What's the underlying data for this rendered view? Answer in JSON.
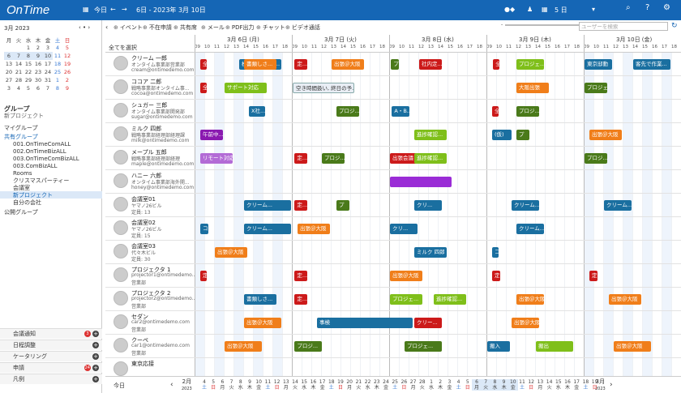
{
  "app": {
    "logo": "OnTime",
    "today": "今日",
    "range": "6日 - 2023年 3月 10日",
    "days": "5 日"
  },
  "calendar": {
    "title": "3月 2023",
    "weekdays": [
      "月",
      "火",
      "水",
      "木",
      "金",
      "土",
      "日"
    ],
    "weeks": [
      [
        "",
        "",
        "1",
        "2",
        "3",
        "4",
        "5"
      ],
      [
        "6",
        "7",
        "8",
        "9",
        "10",
        "11",
        "12"
      ],
      [
        "13",
        "14",
        "15",
        "16",
        "17",
        "18",
        "19"
      ],
      [
        "20",
        "21",
        "22",
        "23",
        "24",
        "25",
        "26"
      ],
      [
        "27",
        "28",
        "29",
        "30",
        "31",
        "1",
        "2"
      ],
      [
        "3",
        "4",
        "5",
        "6",
        "7",
        "8",
        "9"
      ]
    ]
  },
  "groups": {
    "header": "グループ",
    "sub": "新プロジェクト",
    "my": "マイグループ",
    "shared": "共有グループ",
    "items": [
      "001.OnTimeComALL",
      "002.OnTimeBizALL",
      "003.OnTimeComBizALL",
      "003.ComBizALL",
      "Rooms",
      "クリスマスパーティー",
      "会議室",
      "新プロジェクト",
      "自分の会社"
    ],
    "public": "公開グループ"
  },
  "leftbar": [
    {
      "label": "会議通知",
      "badge": "3"
    },
    {
      "label": "日程調整",
      "badge": ""
    },
    {
      "label": "ケータリング",
      "badge": ""
    },
    {
      "label": "申請",
      "badge": "24"
    },
    {
      "label": "凡例",
      "badge": ""
    }
  ],
  "toolbar": [
    "イベント",
    "不在申請",
    "共有席",
    "メール",
    "PDF出力",
    "チャット",
    "ビデオ通話"
  ],
  "search_placeholder": "ユーザーを検索",
  "select_all": "全てを選択",
  "days": [
    {
      "label": "3月 6日 (月)"
    },
    {
      "label": "3月 7日 (火)"
    },
    {
      "label": "3月 8日 (水)"
    },
    {
      "label": "3月 9日 (木)"
    },
    {
      "label": "3月 10日 (金)"
    }
  ],
  "hours": [
    "09",
    "10",
    "11",
    "12",
    "13",
    "14",
    "15",
    "16",
    "17",
    "18"
  ],
  "rows": [
    {
      "name": "クリーム 一郎",
      "s1": "オンタイム事業部営業部",
      "s2": "cream@ontimedemo.com"
    },
    {
      "name": "ココア 二郎",
      "s1": "戦略事業部オンタイム事...",
      "s2": "cocoa@ontimedemo.com"
    },
    {
      "name": "シュガー 三郎",
      "s1": "オンタイム事業部開発部",
      "s2": "sugar@ontimedemo.com"
    },
    {
      "name": "ミルク 四郎",
      "s1": "戦略事業部経理部経理課",
      "s2": "milk@ontimedemo.com"
    },
    {
      "name": "メープル 五郎",
      "s1": "戦略事業部経理部経理",
      "s2": "maple@ontimedemo.com"
    },
    {
      "name": "ハニー 六郎",
      "s1": "オンタイム事業部海外開...",
      "s2": "honey@ontimedemo.com"
    },
    {
      "name": "会議室01",
      "s1": "ヤマノ26ビル",
      "s2": "定員: 13"
    },
    {
      "name": "会議室02",
      "s1": "ヤマノ26ビル",
      "s2": "定員: 15"
    },
    {
      "name": "会議室03",
      "s1": "代々木ビル",
      "s2": "定員: 30"
    },
    {
      "name": "プロジェクタ 1",
      "s1": "projector1@ontimedemo...",
      "s2": "営業部"
    },
    {
      "name": "プロジェクタ 2",
      "s1": "projector2@ontimedemo...",
      "s2": "営業部"
    },
    {
      "name": "セダン",
      "s1": "car2@ontimedemo.com",
      "s2": "営業部"
    },
    {
      "name": "クーペ",
      "s1": "car1@ontimedemo.com",
      "s2": "営業部"
    },
    {
      "name": "東京応接",
      "s1": "",
      "s2": ""
    }
  ],
  "events": [
    {
      "r": 0,
      "d": 0,
      "h": 0.5,
      "w": 0.8,
      "t": "全...",
      "c": "#cc1a1a"
    },
    {
      "r": 0,
      "d": 0,
      "h": 4.5,
      "w": 4.5,
      "t": "株式会社OnTi...",
      "c": "#1a6fa0"
    },
    {
      "r": 0,
      "d": 0,
      "h": 5.0,
      "w": 3.5,
      "t": "書類しさ...",
      "c": "#f07e1a"
    },
    {
      "r": 0,
      "d": 1,
      "h": 0.2,
      "w": 1.5,
      "t": "定...",
      "c": "#cc1a1a"
    },
    {
      "r": 0,
      "d": 1,
      "h": 4.0,
      "w": 3.5,
      "t": "出張＠大阪",
      "c": "#f07e1a"
    },
    {
      "r": 0,
      "d": 2,
      "h": 0.1,
      "w": 1.0,
      "t": "プ",
      "c": "#4a7a1a"
    },
    {
      "r": 0,
      "d": 2,
      "h": 3.0,
      "w": 2.5,
      "t": "社内定...",
      "c": "#cc1a1a"
    },
    {
      "r": 0,
      "d": 3,
      "h": 0.6,
      "w": 0.8,
      "t": "全",
      "c": "#cc1a1a"
    },
    {
      "r": 0,
      "d": 3,
      "h": 3.0,
      "w": 3.0,
      "t": "プロジェ...",
      "c": "#7fbf1a"
    },
    {
      "r": 0,
      "d": 4,
      "h": 0.0,
      "w": 3.0,
      "t": "東京邸動",
      "c": "#1a6fa0"
    },
    {
      "r": 0,
      "d": 4,
      "h": 5.0,
      "w": 4.0,
      "t": "客先で作業...",
      "c": "#1a6fa0"
    },
    {
      "r": 1,
      "d": 0,
      "h": 0.5,
      "w": 0.8,
      "t": "全",
      "c": "#cc1a1a"
    },
    {
      "r": 1,
      "d": 0,
      "h": 3.0,
      "w": 4.5,
      "t": "サポート対応",
      "c": "#7fbf1a"
    },
    {
      "r": 1,
      "d": 1,
      "h": 0.0,
      "w": 6.5,
      "t": "空き時間扱い, 終日の予...",
      "c": "#e9eef5"
    },
    {
      "r": 1,
      "d": 3,
      "h": 3.0,
      "w": 3.5,
      "t": "大阪出張",
      "c": "#f07e1a"
    },
    {
      "r": 1,
      "d": 4,
      "h": 0.0,
      "w": 2.5,
      "t": "プロジェ...",
      "c": "#4a7a1a"
    },
    {
      "r": 2,
      "d": 0,
      "h": 5.5,
      "w": 1.8,
      "t": "X社...",
      "c": "#1a6fa0"
    },
    {
      "r": 2,
      "d": 1,
      "h": 4.5,
      "w": 2.5,
      "t": "プロジ...",
      "c": "#4a7a1a"
    },
    {
      "r": 2,
      "d": 2,
      "h": 0.2,
      "w": 2.0,
      "t": "A・B...",
      "c": "#1a6fa0"
    },
    {
      "r": 2,
      "d": 3,
      "h": 0.5,
      "w": 0.8,
      "t": "全",
      "c": "#cc1a1a"
    },
    {
      "r": 2,
      "d": 3,
      "h": 3.0,
      "w": 2.5,
      "t": "プロジ...",
      "c": "#4a7a1a"
    },
    {
      "r": 3,
      "d": 0,
      "h": 0.5,
      "w": 2.5,
      "t": "午前中...",
      "c": "#8a1ab0"
    },
    {
      "r": 3,
      "d": 2,
      "h": 2.5,
      "w": 3.5,
      "t": "進捗確認...",
      "c": "#7fbf1a"
    },
    {
      "r": 3,
      "d": 3,
      "h": 0.5,
      "w": 2.2,
      "t": "(仮)",
      "c": "#1a6fa0"
    },
    {
      "r": 3,
      "d": 3,
      "h": 3.0,
      "w": 1.5,
      "t": "プ",
      "c": "#4a7a1a"
    },
    {
      "r": 3,
      "d": 4,
      "h": 0.5,
      "w": 3.5,
      "t": "出張＠大阪",
      "c": "#f07e1a"
    },
    {
      "r": 4,
      "d": 0,
      "h": 0.5,
      "w": 3.5,
      "t": "リモート対応",
      "c": "#b36bd6"
    },
    {
      "r": 4,
      "d": 1,
      "h": 0.2,
      "w": 1.5,
      "t": "定...",
      "c": "#cc1a1a"
    },
    {
      "r": 4,
      "d": 1,
      "h": 3.0,
      "w": 2.5,
      "t": "プロジ...",
      "c": "#4a7a1a"
    },
    {
      "r": 4,
      "d": 2,
      "h": 0.0,
      "w": 4.5,
      "t": "出張会議",
      "c": "#cc1a1a"
    },
    {
      "r": 4,
      "d": 2,
      "h": 2.5,
      "w": 3.5,
      "t": "進捗確認...",
      "c": "#7fbf1a"
    },
    {
      "r": 4,
      "d": 4,
      "h": 0.0,
      "w": 2.5,
      "t": "プロジ...",
      "c": "#4a7a1a"
    },
    {
      "r": 5,
      "d": 2,
      "h": 0.0,
      "w": 6.5,
      "t": "",
      "c": "#9a2cd6"
    },
    {
      "r": 6,
      "d": 0,
      "h": 5.0,
      "w": 5.0,
      "t": "クリーム...",
      "c": "#1a6fa0"
    },
    {
      "r": 6,
      "d": 1,
      "h": 0.2,
      "w": 1.5,
      "t": "定...",
      "c": "#cc1a1a"
    },
    {
      "r": 6,
      "d": 1,
      "h": 4.5,
      "w": 1.5,
      "t": "プ",
      "c": "#4a7a1a"
    },
    {
      "r": 6,
      "d": 2,
      "h": 2.5,
      "w": 3.0,
      "t": "クリ...",
      "c": "#1a6fa0"
    },
    {
      "r": 6,
      "d": 3,
      "h": 2.5,
      "w": 3.0,
      "t": "クリーム...",
      "c": "#1a6fa0"
    },
    {
      "r": 6,
      "d": 4,
      "h": 2.0,
      "w": 3.0,
      "t": "クリーム...",
      "c": "#1a6fa0"
    },
    {
      "r": 7,
      "d": 0,
      "h": 0.5,
      "w": 1.0,
      "t": "コ",
      "c": "#1a6fa0"
    },
    {
      "r": 7,
      "d": 0,
      "h": 5.0,
      "w": 5.0,
      "t": "クリーム...",
      "c": "#1a6fa0"
    },
    {
      "r": 7,
      "d": 1,
      "h": 0.5,
      "w": 3.5,
      "t": "出張＠大阪",
      "c": "#f07e1a"
    },
    {
      "r": 7,
      "d": 2,
      "h": 0.0,
      "w": 3.0,
      "t": "クリ...",
      "c": "#1a6fa0"
    },
    {
      "r": 7,
      "d": 3,
      "h": 3.0,
      "w": 3.0,
      "t": "クリーム...",
      "c": "#1a6fa0"
    },
    {
      "r": 8,
      "d": 0,
      "h": 2.0,
      "w": 3.5,
      "t": "出張＠大阪",
      "c": "#f07e1a"
    },
    {
      "r": 8,
      "d": 2,
      "h": 2.5,
      "w": 3.5,
      "t": "ミルク 四郎",
      "c": "#1a6fa0"
    },
    {
      "r": 8,
      "d": 3,
      "h": 0.5,
      "w": 0.8,
      "t": "コ",
      "c": "#1a6fa0"
    },
    {
      "r": 9,
      "d": 0,
      "h": 0.5,
      "w": 0.8,
      "t": "定",
      "c": "#cc1a1a"
    },
    {
      "r": 9,
      "d": 1,
      "h": 0.2,
      "w": 1.5,
      "t": "定...",
      "c": "#cc1a1a"
    },
    {
      "r": 9,
      "d": 2,
      "h": 0.0,
      "w": 3.5,
      "t": "出張＠大阪",
      "c": "#f07e1a"
    },
    {
      "r": 9,
      "d": 3,
      "h": 0.5,
      "w": 1.0,
      "t": "定",
      "c": "#cc1a1a"
    },
    {
      "r": 9,
      "d": 4,
      "h": 0.5,
      "w": 1.0,
      "t": "定",
      "c": "#cc1a1a"
    },
    {
      "r": 10,
      "d": 0,
      "h": 5.0,
      "w": 3.5,
      "t": "書類しさ...",
      "c": "#1a6fa0"
    },
    {
      "r": 10,
      "d": 1,
      "h": 0.2,
      "w": 1.5,
      "t": "定...",
      "c": "#cc1a1a"
    },
    {
      "r": 10,
      "d": 2,
      "h": 0.0,
      "w": 3.5,
      "t": "プロジェ...",
      "c": "#7fbf1a"
    },
    {
      "r": 10,
      "d": 2,
      "h": 4.5,
      "w": 3.5,
      "t": "進捗確認...",
      "c": "#7fbf1a"
    },
    {
      "r": 10,
      "d": 3,
      "h": 3.0,
      "w": 3.0,
      "t": "出張＠大阪",
      "c": "#f07e1a"
    },
    {
      "r": 10,
      "d": 4,
      "h": 2.5,
      "w": 3.5,
      "t": "出張＠大阪",
      "c": "#f07e1a"
    },
    {
      "r": 11,
      "d": 0,
      "h": 5.0,
      "w": 4.0,
      "t": "出張＠大阪",
      "c": "#f07e1a"
    },
    {
      "r": 11,
      "d": 1,
      "h": 2.5,
      "w": 10.0,
      "t": "事検",
      "c": "#1a6fa0"
    },
    {
      "r": 11,
      "d": 2,
      "h": 2.5,
      "w": 3.0,
      "t": "クリー...",
      "c": "#cc1a1a"
    },
    {
      "r": 11,
      "d": 3,
      "h": 2.5,
      "w": 3.0,
      "t": "出張＠大阪",
      "c": "#f07e1a"
    },
    {
      "r": 12,
      "d": 0,
      "h": 3.0,
      "w": 4.0,
      "t": "出張＠大阪",
      "c": "#f07e1a"
    },
    {
      "r": 12,
      "d": 1,
      "h": 0.2,
      "w": 3.0,
      "t": "プロジ...",
      "c": "#4a7a1a"
    },
    {
      "r": 12,
      "d": 2,
      "h": 1.5,
      "w": 4.0,
      "t": "プロジェ...",
      "c": "#4a7a1a"
    },
    {
      "r": 12,
      "d": 3,
      "h": 0.0,
      "w": 2.5,
      "t": "搬入",
      "c": "#1a6fa0"
    },
    {
      "r": 12,
      "d": 3,
      "h": 5.0,
      "w": 4.0,
      "t": "搬出",
      "c": "#7fbf1a"
    },
    {
      "r": 12,
      "d": 4,
      "h": 3.0,
      "w": 4.0,
      "t": "出張＠大阪",
      "c": "#f07e1a"
    }
  ],
  "bottom": {
    "today": "今日",
    "month_prev": "2月",
    "year_prev": "2023",
    "month_next": "3月",
    "year_next": "2023",
    "days": [
      [
        "4",
        "土"
      ],
      [
        "5",
        "日"
      ],
      [
        "6",
        "月"
      ],
      [
        "7",
        "火"
      ],
      [
        "8",
        "水"
      ],
      [
        "9",
        "木"
      ],
      [
        "10",
        "金"
      ],
      [
        "11",
        "土"
      ],
      [
        "12",
        "日"
      ],
      [
        "13",
        "月"
      ],
      [
        "14",
        "火"
      ],
      [
        "15",
        "水"
      ],
      [
        "16",
        "木"
      ],
      [
        "17",
        "金"
      ],
      [
        "18",
        "土"
      ],
      [
        "19",
        "日"
      ],
      [
        "20",
        "月"
      ],
      [
        "21",
        "火"
      ],
      [
        "22",
        "水"
      ],
      [
        "23",
        "木"
      ],
      [
        "24",
        "金"
      ],
      [
        "25",
        "土"
      ],
      [
        "26",
        "日"
      ],
      [
        "27",
        "月"
      ],
      [
        "28",
        "火"
      ],
      [
        "1",
        "水"
      ],
      [
        "2",
        "木"
      ],
      [
        "3",
        "金"
      ],
      [
        "4",
        "土"
      ],
      [
        "5",
        "日"
      ],
      [
        "6",
        "月"
      ],
      [
        "7",
        "火"
      ],
      [
        "8",
        "水"
      ],
      [
        "9",
        "木"
      ],
      [
        "10",
        "金"
      ],
      [
        "11",
        "土"
      ],
      [
        "12",
        "日"
      ],
      [
        "13",
        "月"
      ],
      [
        "14",
        "火"
      ],
      [
        "15",
        "水"
      ],
      [
        "16",
        "木"
      ],
      [
        "17",
        "金"
      ],
      [
        "18",
        "土"
      ],
      [
        "19",
        "日"
      ]
    ]
  }
}
